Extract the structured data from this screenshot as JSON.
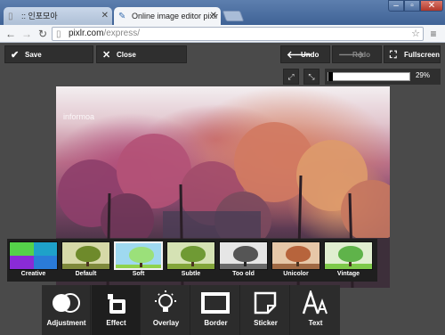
{
  "browser": {
    "tabs": [
      {
        "title": ":: 인포모아"
      },
      {
        "title": "Online image editor pixlr"
      }
    ],
    "url_host": "pixlr.com",
    "url_path": "/express/"
  },
  "toolbar": {
    "save_label": "Save",
    "close_label": "Close",
    "undo_label": "Undo",
    "redo_label": "Redo",
    "fullscreen_label": "Fullscreen"
  },
  "zoom": {
    "value_label": "29%",
    "value": 0.29
  },
  "canvas": {
    "watermark": "informoa"
  },
  "effects": [
    {
      "label": "Creative"
    },
    {
      "label": "Default"
    },
    {
      "label": "Soft"
    },
    {
      "label": "Subtle"
    },
    {
      "label": "Too old"
    },
    {
      "label": "Unicolor"
    },
    {
      "label": "Vintage"
    }
  ],
  "selected_effect": "Soft",
  "tools": [
    {
      "label": "Adjustment",
      "icon": "adjustment-icon"
    },
    {
      "label": "Effect",
      "icon": "effect-icon"
    },
    {
      "label": "Overlay",
      "icon": "overlay-icon"
    },
    {
      "label": "Border",
      "icon": "border-icon"
    },
    {
      "label": "Sticker",
      "icon": "sticker-icon"
    },
    {
      "label": "Text",
      "icon": "text-icon"
    }
  ],
  "selected_tool": "Effect",
  "colors": {
    "app_bg": "#4a4a4a",
    "button_bg": "#2f2f2f",
    "chrome_blue": "#4f72a6"
  }
}
